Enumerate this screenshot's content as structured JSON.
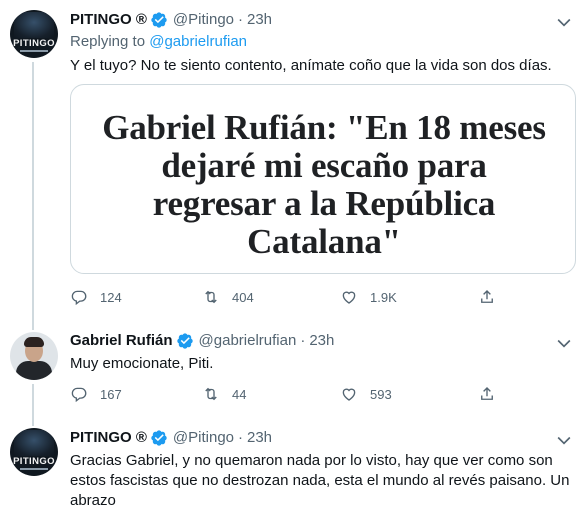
{
  "tweets": [
    {
      "name": "PITINGO",
      "name_suffix": "®",
      "handle": "@Pitingo",
      "separator": "·",
      "time": "23h",
      "avatar_text": "PITINGO",
      "replying_prefix": "Replying to",
      "replying_to": "@gabrielrufian",
      "text": "Y el tuyo? No te siento contento, anímate coño que la vida son dos días.",
      "media_headline": [
        "Gabriel Rufián: \"En 18 meses",
        "dejaré mi escaño para",
        "regresar a la República",
        "Catalana\""
      ],
      "replies": "124",
      "retweets": "404",
      "likes": "1.9K"
    },
    {
      "name": "Gabriel Rufián",
      "handle": "@gabrielrufian",
      "separator": "·",
      "time": "23h",
      "text": "Muy emocionate, Piti.",
      "replies": "167",
      "retweets": "44",
      "likes": "593"
    },
    {
      "name": "PITINGO",
      "name_suffix": "®",
      "handle": "@Pitingo",
      "separator": "·",
      "time": "23h",
      "avatar_text": "PITINGO",
      "text_lines": [
        "Gracias Gabriel, y no quemaron nada por lo visto, hay que ver como son",
        "estos fascistas que no destrozan nada, esta el mundo al revés paisano. Un",
        "abrazo"
      ]
    }
  ],
  "colors": {
    "verified": "#1d9bf0",
    "link": "#1d9bf0",
    "secondary_text": "#536471",
    "thread_line": "#cfd9de"
  },
  "icons": [
    "verified-badge-icon",
    "chevron-down-icon",
    "reply-icon",
    "retweet-icon",
    "like-icon",
    "share-icon"
  ]
}
